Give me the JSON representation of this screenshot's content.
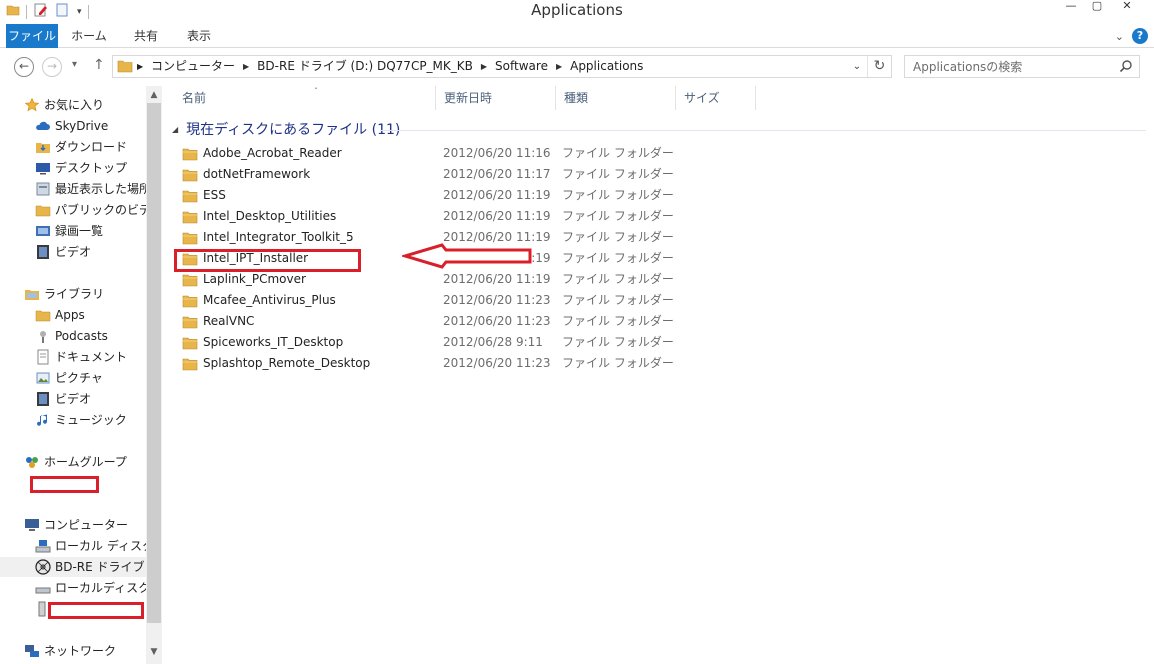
{
  "window": {
    "title": "Applications"
  },
  "ribbon": {
    "tabs": [
      "ファイル",
      "ホーム",
      "共有",
      "表示"
    ]
  },
  "address": {
    "crumbs": [
      "コンピューター",
      "BD-RE ドライブ (D:) DQ77CP_MK_KB",
      "Software",
      "Applications"
    ]
  },
  "search": {
    "placeholder": "Applicationsの検索"
  },
  "navpane": {
    "favorites": {
      "label": "お気に入り",
      "items": [
        "SkyDrive",
        "ダウンロード",
        "デスクトップ",
        "最近表示した場所",
        "パブリックのビデオ",
        "録画一覧",
        "ビデオ"
      ]
    },
    "libraries": {
      "label": "ライブラリ",
      "items": [
        "Apps",
        "Podcasts",
        "ドキュメント",
        "ピクチャ",
        "ビデオ",
        "ミュージック"
      ]
    },
    "homegroup": {
      "label": "ホームグループ"
    },
    "computer": {
      "label": "コンピューター",
      "items": [
        "ローカル ディスク (C",
        "BD-RE ドライブ (D",
        "ローカルディスク (E"
      ]
    },
    "network": {
      "label": "ネットワーク"
    }
  },
  "columns": [
    "名前",
    "更新日時",
    "種類",
    "サイズ"
  ],
  "group": {
    "label": "現在ディスクにあるファイル (11)"
  },
  "files": [
    {
      "name": "Adobe_Acrobat_Reader",
      "date": "2012/06/20 11:16",
      "type": "ファイル フォルダー"
    },
    {
      "name": "dotNetFramework",
      "date": "2012/06/20 11:17",
      "type": "ファイル フォルダー"
    },
    {
      "name": "ESS",
      "date": "2012/06/20 11:19",
      "type": "ファイル フォルダー"
    },
    {
      "name": "Intel_Desktop_Utilities",
      "date": "2012/06/20 11:19",
      "type": "ファイル フォルダー"
    },
    {
      "name": "Intel_Integrator_Toolkit_5",
      "date": "2012/06/20 11:19",
      "type": "ファイル フォルダー"
    },
    {
      "name": "Intel_IPT_Installer",
      "date": "2012/06/20 11:19",
      "type": "ファイル フォルダー"
    },
    {
      "name": "Laplink_PCmover",
      "date": "2012/06/20 11:19",
      "type": "ファイル フォルダー"
    },
    {
      "name": "Mcafee_Antivirus_Plus",
      "date": "2012/06/20 11:23",
      "type": "ファイル フォルダー"
    },
    {
      "name": "RealVNC",
      "date": "2012/06/20 11:23",
      "type": "ファイル フォルダー"
    },
    {
      "name": "Spiceworks_IT_Desktop",
      "date": "2012/06/28 9:11",
      "type": "ファイル フォルダー"
    },
    {
      "name": "Splashtop_Remote_Desktop",
      "date": "2012/06/20 11:23",
      "type": "ファイル フォルダー"
    }
  ],
  "colors": {
    "accent": "#1979ca",
    "group_text": "#1e3287",
    "annotation_red": "#d9202a",
    "folder": "#e8b54a"
  }
}
